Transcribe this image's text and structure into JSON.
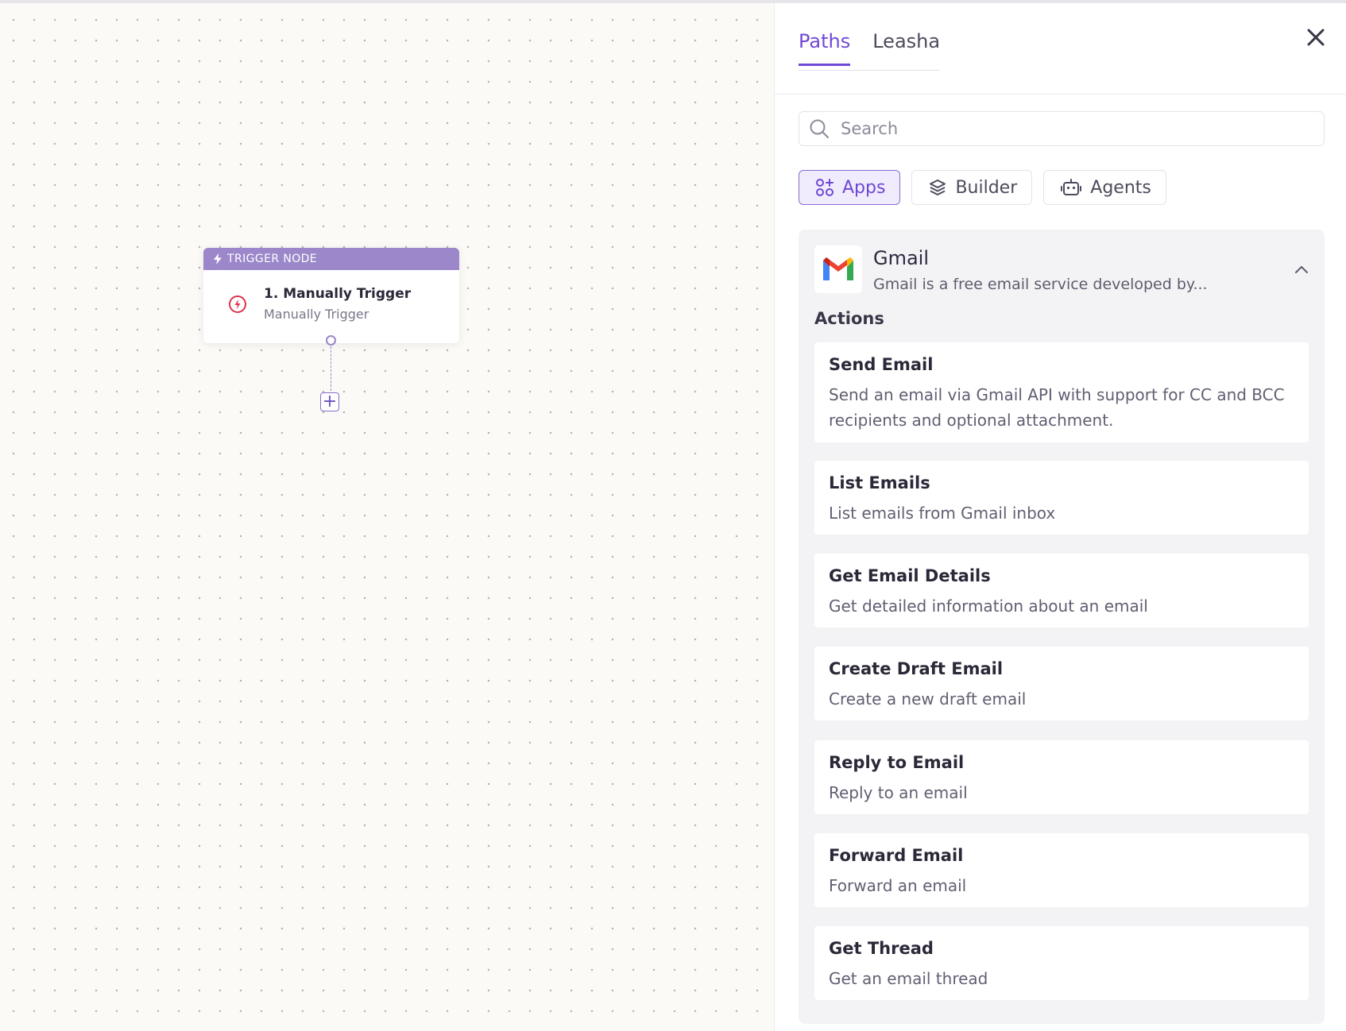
{
  "canvas": {
    "trigger_node": {
      "header": "TRIGGER NODE",
      "title": "1. Manually Trigger",
      "subtitle": "Manually Trigger"
    }
  },
  "panel": {
    "tabs": [
      {
        "label": "Paths",
        "active": true
      },
      {
        "label": "Leasha",
        "active": false
      }
    ],
    "search": {
      "placeholder": "Search",
      "value": ""
    },
    "filters": [
      {
        "label": "Apps",
        "icon": "apps-icon",
        "active": true
      },
      {
        "label": "Builder",
        "icon": "layers-icon",
        "active": false
      },
      {
        "label": "Agents",
        "icon": "robot-icon",
        "active": false
      }
    ],
    "app": {
      "name": "Gmail",
      "description": "Gmail is a free email service developed by...",
      "actions_label": "Actions",
      "actions": [
        {
          "title": "Send Email",
          "description": "Send an email via Gmail API with support for CC and BCC recipients and optional attachment."
        },
        {
          "title": "List Emails",
          "description": "List emails from Gmail inbox"
        },
        {
          "title": "Get Email Details",
          "description": "Get detailed information about an email"
        },
        {
          "title": "Create Draft Email",
          "description": "Create a new draft email"
        },
        {
          "title": "Reply to Email",
          "description": "Reply to an email"
        },
        {
          "title": "Forward Email",
          "description": "Forward an email"
        },
        {
          "title": "Get Thread",
          "description": "Get an email thread"
        }
      ]
    }
  },
  "colors": {
    "accent": "#7048d6",
    "node_header": "#9b87c9",
    "trigger_icon": "#e0304f"
  }
}
